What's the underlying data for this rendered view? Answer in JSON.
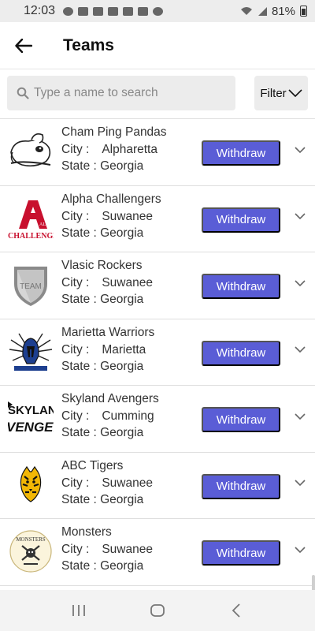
{
  "status_bar": {
    "time": "12:03",
    "battery": "81%"
  },
  "header": {
    "title": "Teams",
    "back_icon": "arrow-left-icon"
  },
  "search": {
    "placeholder": "Type a name to search",
    "value": ""
  },
  "filter": {
    "label": "Filter"
  },
  "labels": {
    "city": "City :",
    "state_prefix": "State : "
  },
  "withdraw_label": "Withdraw",
  "teams": [
    {
      "name": "Cham Ping Pandas",
      "city": "Alpharetta",
      "state": "Georgia",
      "logo": "panda-logo"
    },
    {
      "name": "Alpha Challengers",
      "city": "Suwanee",
      "state": "Georgia",
      "logo": "alpha-challengers-logo",
      "logo_text": "CHALLENGER"
    },
    {
      "name": "Vlasic Rockers",
      "city": "Suwanee",
      "state": "Georgia",
      "logo": "shield-team-logo",
      "logo_text": "TEAM"
    },
    {
      "name": "Marietta Warriors",
      "city": "Marietta",
      "state": "Georgia",
      "logo": "spartan-helmet-logo"
    },
    {
      "name": "Skyland Avengers",
      "city": "Cumming",
      "state": "Georgia",
      "logo": "skyland-avengers-logo",
      "logo_text_1": "SKYLANI",
      "logo_text_2": "VENGERS"
    },
    {
      "name": "ABC Tigers",
      "city": "Suwanee",
      "state": "Georgia",
      "logo": "tiger-logo"
    },
    {
      "name": "Monsters",
      "city": "Suwanee",
      "state": "Georgia",
      "logo": "monsters-logo",
      "logo_text": "MONSTERS"
    }
  ],
  "colors": {
    "accent": "#5a5dd6",
    "surface": "#ececec"
  }
}
